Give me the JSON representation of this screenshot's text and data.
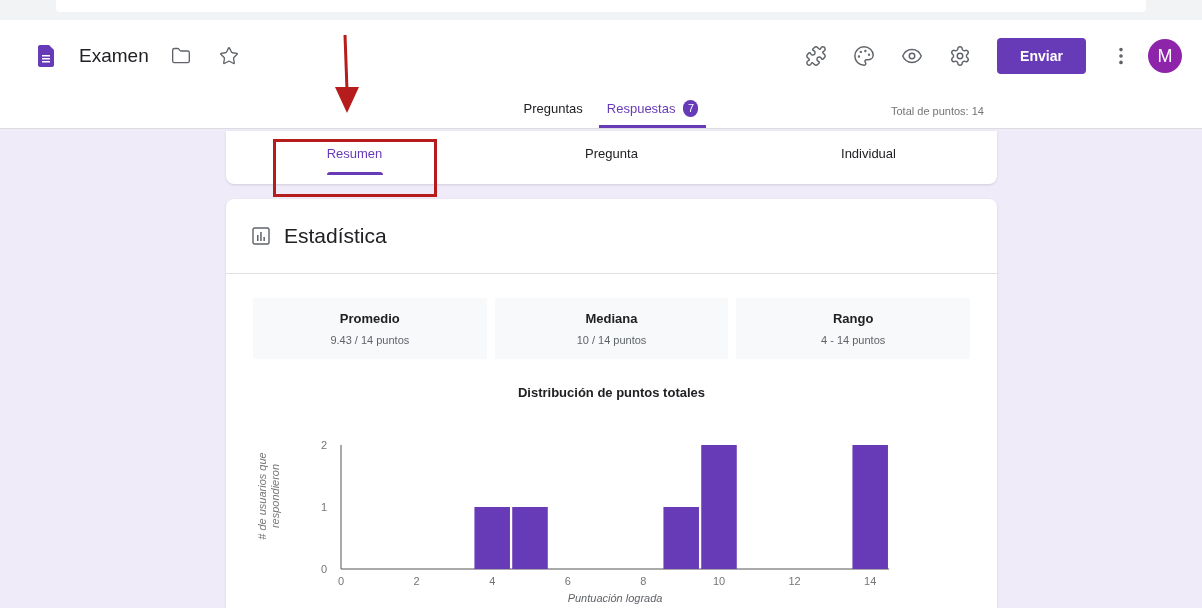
{
  "header": {
    "title": "Examen",
    "send_button": "Enviar",
    "avatar": "M"
  },
  "tabs": [
    {
      "label": "Preguntas",
      "selected": false
    },
    {
      "label": "Respuestas",
      "selected": true,
      "badge": "7"
    }
  ],
  "total_points": "Total de puntos: 14",
  "subtabs": [
    {
      "label": "Resumen",
      "selected": true
    },
    {
      "label": "Pregunta",
      "selected": false
    },
    {
      "label": "Individual",
      "selected": false
    }
  ],
  "stats": {
    "title": "Estadística",
    "cards": [
      {
        "label": "Promedio",
        "value": "9.43 / 14 puntos"
      },
      {
        "label": "Mediana",
        "value": "10 / 14 puntos"
      },
      {
        "label": "Rango",
        "value": "4 - 14 puntos"
      }
    ],
    "chart_data": {
      "type": "bar",
      "title": "Distribución de puntos totales",
      "xlabel": "Puntuación lograda",
      "ylabel": "# de usuarios que respondieron",
      "x": [
        4,
        5,
        9,
        10,
        14
      ],
      "series": [
        {
          "color": "#673ab7",
          "values": [
            1,
            1,
            1,
            2,
            2
          ]
        }
      ],
      "xlim": [
        0,
        14.5
      ],
      "ylim": [
        0,
        2
      ],
      "xticks": [
        0,
        2,
        4,
        6,
        8,
        10,
        12,
        14
      ],
      "yticks": [
        0,
        1,
        2
      ]
    }
  }
}
